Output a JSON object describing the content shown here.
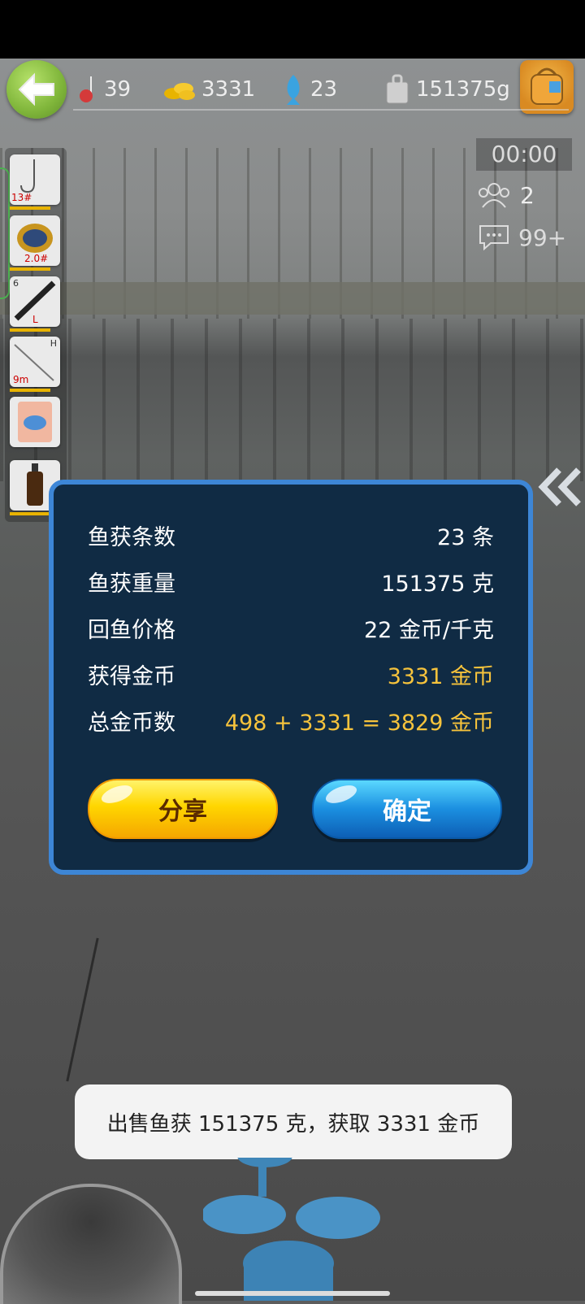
{
  "topbar": {
    "hooks": "39",
    "coins": "3331",
    "fish": "23",
    "weight": "151375g"
  },
  "hud": {
    "timer": "00:00",
    "players": "2",
    "messages": "99+"
  },
  "toolbar": {
    "hook_label": "13#",
    "line_label": "2.0#",
    "float_num": "6",
    "float_size": "L",
    "rod_letter": "H",
    "rod_length": "9m"
  },
  "result": {
    "rows": [
      {
        "label": "鱼获条数",
        "value": "23 条"
      },
      {
        "label": "鱼获重量",
        "value": "151375 克"
      },
      {
        "label": "回鱼价格",
        "value": "22 金币/千克"
      },
      {
        "label": "获得金币",
        "value": "3331 金币"
      },
      {
        "label": "总金币数",
        "value": "498 + 3331 = 3829 金币"
      }
    ],
    "share_label": "分享",
    "confirm_label": "确定"
  },
  "toast": "出售鱼获 151375 克，获取 3331 金币",
  "colors": {
    "gold": "#f6c33c",
    "modal_bg": "#102b44",
    "modal_border": "#3d86d6"
  }
}
